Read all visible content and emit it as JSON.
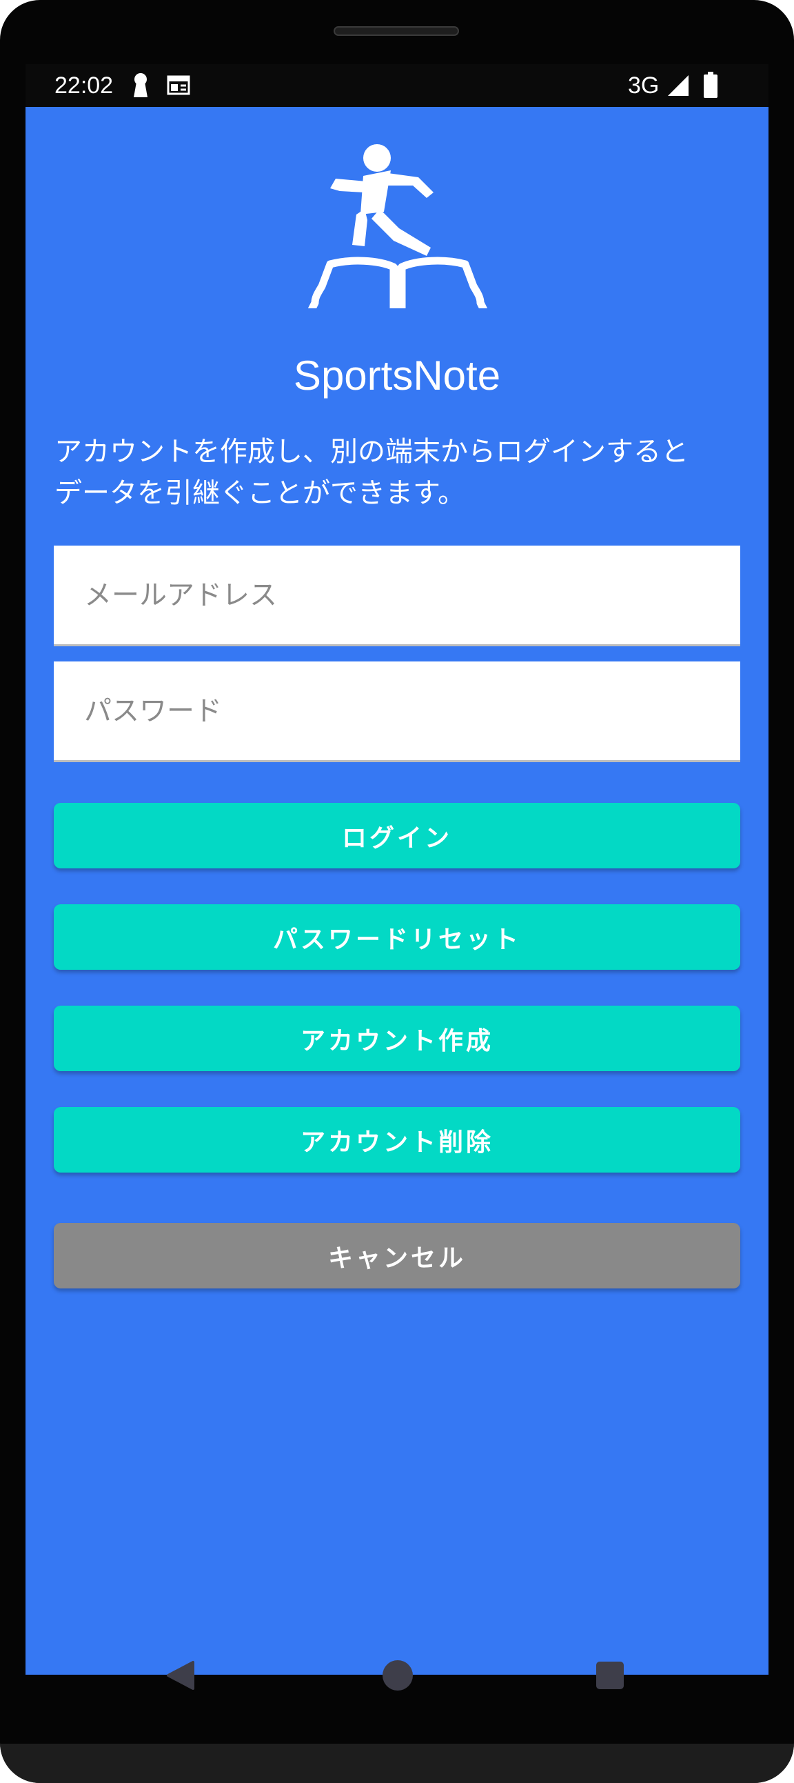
{
  "status_bar": {
    "time": "22:02",
    "network": "3G",
    "icons": [
      "notification-keyhole-icon",
      "calendar-icon",
      "signal-icon",
      "battery-icon"
    ]
  },
  "app": {
    "name": "SportsNote",
    "logo_icon": "runner-on-book-icon",
    "description_line1": "アカウントを作成し、別の端末からログインすると",
    "description_line2": "データを引継ぐことができます。"
  },
  "form": {
    "email_placeholder": "メールアドレス",
    "email_value": "",
    "password_placeholder": "パスワード",
    "password_value": ""
  },
  "buttons": {
    "login": "ログイン",
    "password_reset": "パスワードリセット",
    "create_account": "アカウント作成",
    "delete_account": "アカウント削除",
    "cancel": "キャンセル"
  },
  "navigation": {
    "icons": [
      "back-icon",
      "home-icon",
      "recents-icon"
    ]
  },
  "colors": {
    "background": "#3678f3",
    "primary_button": "#03d9c5",
    "cancel_button": "#898989",
    "text_light": "#ffffff"
  }
}
